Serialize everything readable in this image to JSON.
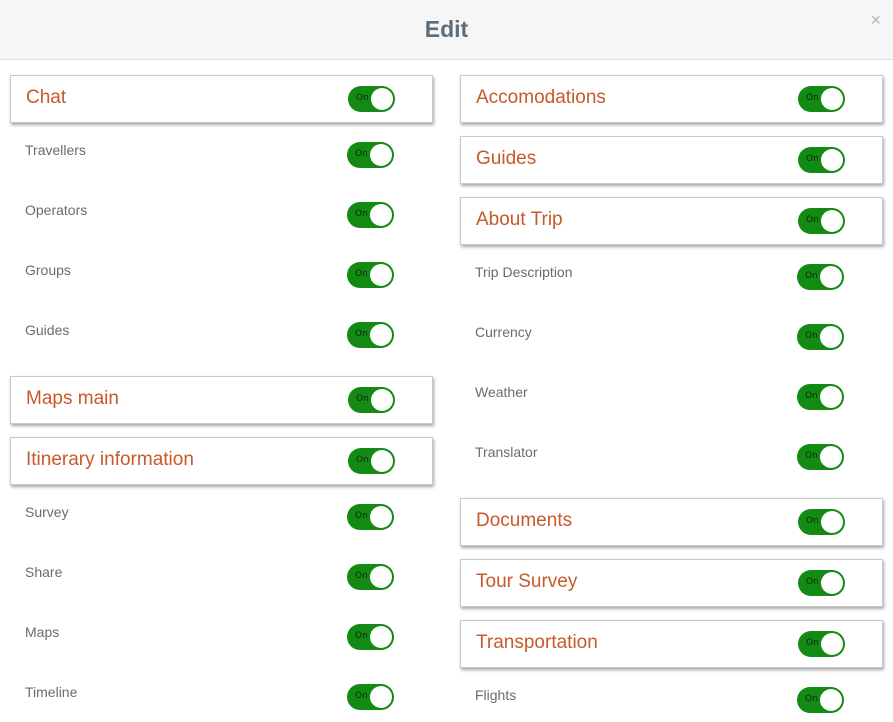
{
  "header": {
    "title": "Edit",
    "close_glyph": "×"
  },
  "toggle_on_label": "On",
  "accent_color": "#c7592a",
  "toggle_color": "#138a14",
  "left": [
    {
      "label": "Chat",
      "type": "section",
      "state": "On"
    },
    {
      "label": "Travellers",
      "type": "item",
      "state": "On"
    },
    {
      "label": "Operators",
      "type": "item",
      "state": "On"
    },
    {
      "label": "Groups",
      "type": "item",
      "state": "On"
    },
    {
      "label": "Guides",
      "type": "item",
      "state": "On"
    },
    {
      "label": "Maps main",
      "type": "section",
      "state": "On"
    },
    {
      "label": "Itinerary information",
      "type": "section",
      "state": "On"
    },
    {
      "label": "Survey",
      "type": "item",
      "state": "On"
    },
    {
      "label": "Share",
      "type": "item",
      "state": "On"
    },
    {
      "label": "Maps",
      "type": "item",
      "state": "On"
    },
    {
      "label": "Timeline",
      "type": "item",
      "state": "On"
    }
  ],
  "right": [
    {
      "label": "Accomodations",
      "type": "section",
      "state": "On"
    },
    {
      "label": "Guides",
      "type": "section",
      "state": "On"
    },
    {
      "label": "About Trip",
      "type": "section",
      "state": "On"
    },
    {
      "label": "Trip Description",
      "type": "item",
      "state": "On"
    },
    {
      "label": "Currency",
      "type": "item",
      "state": "On"
    },
    {
      "label": "Weather",
      "type": "item",
      "state": "On"
    },
    {
      "label": "Translator",
      "type": "item",
      "state": "On"
    },
    {
      "label": "Documents",
      "type": "section",
      "state": "On"
    },
    {
      "label": "Tour Survey",
      "type": "section",
      "state": "On"
    },
    {
      "label": "Transportation",
      "type": "section",
      "state": "On"
    },
    {
      "label": "Flights",
      "type": "item",
      "state": "On"
    }
  ]
}
